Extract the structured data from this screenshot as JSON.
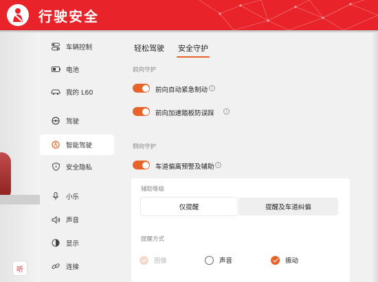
{
  "banner": {
    "title": "行驶安全"
  },
  "sidebar": {
    "items": [
      {
        "label": "车辆控制",
        "icon": "toggle-icon"
      },
      {
        "label": "电池",
        "icon": "battery-icon"
      },
      {
        "label": "我的 L60",
        "icon": "car-icon"
      },
      {
        "label": "驾驶",
        "icon": "steering-wheel-icon"
      },
      {
        "label": "智能驾驶",
        "icon": "smart-drive-icon",
        "active": true
      },
      {
        "label": "安全隐私",
        "icon": "shield-icon"
      },
      {
        "label": "小乐",
        "icon": "microphone-icon"
      },
      {
        "label": "声音",
        "icon": "speaker-icon"
      },
      {
        "label": "显示",
        "icon": "brightness-icon"
      },
      {
        "label": "连接",
        "icon": "link-icon"
      }
    ]
  },
  "tabs": [
    {
      "label": "轻松驾驶",
      "active": false
    },
    {
      "label": "安全守护",
      "active": true
    }
  ],
  "sections": {
    "front_label": "前向守护",
    "side_label": "侧向守护",
    "aeb": {
      "label": "前向自动紧急制动",
      "on": true
    },
    "pedal": {
      "label": "前向加速踏板防误踩",
      "on": true
    },
    "lane": {
      "label": "车道偏离预警及辅助",
      "on": true
    }
  },
  "assist_level": {
    "label": "辅助等级",
    "options": [
      "仅提醒",
      "提醒及车道纠偏"
    ],
    "selected": "仅提醒"
  },
  "alert_method": {
    "label": "提醒方式",
    "options": [
      {
        "label": "图像",
        "state": "disabled-checked"
      },
      {
        "label": "声音",
        "state": "unchecked"
      },
      {
        "label": "振动",
        "state": "checked"
      }
    ]
  },
  "app_badge": "听",
  "colors": {
    "accent": "#e8632a",
    "banner": "#e8242a"
  }
}
